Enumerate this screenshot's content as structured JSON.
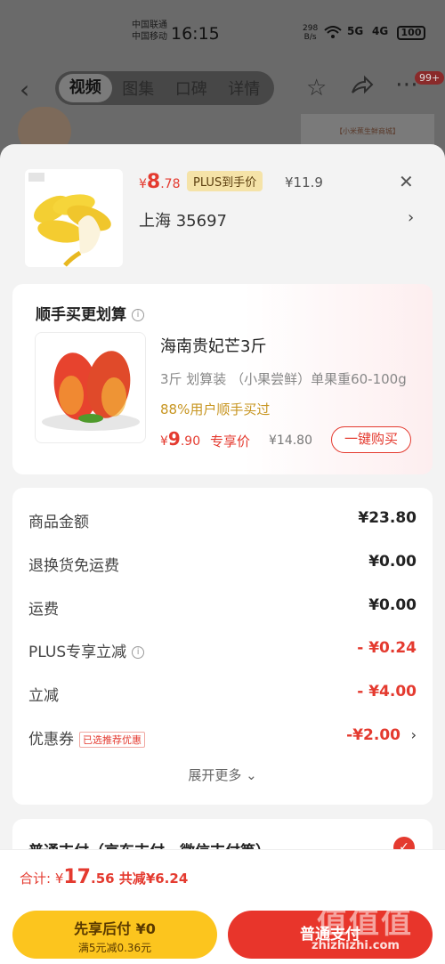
{
  "status_bar": {
    "carrier_1": "中国联通",
    "carrier_2": "中国移动",
    "time": "16:15",
    "net_speed_value": "298",
    "net_speed_unit": "B/s",
    "signal_1": "5G",
    "signal_2": "4G",
    "battery": "100"
  },
  "nav": {
    "tabs": [
      "视频",
      "图集",
      "口碑",
      "详情"
    ],
    "active_tab": "视频",
    "badge": "99+"
  },
  "background": {
    "card_text": "【小米蕉生鲜商城】"
  },
  "product": {
    "currency": "¥",
    "price_int": "8",
    "price_dec": ".78",
    "plus_tag": "PLUS到手价",
    "original_price": "¥11.9",
    "address": "上海  35697"
  },
  "upsell": {
    "title": "顺手买更划算",
    "name": "海南贵妃芒3斤",
    "spec": "3斤 划算装   （小果尝鲜）单果重60-100g",
    "percent": "88%用户顺手买过",
    "currency": "¥",
    "price_int": "9",
    "price_dec": ".90",
    "exclusive_label": "专享价",
    "original_price": "¥14.80",
    "buy_button": "一键购买"
  },
  "costs": {
    "rows": [
      {
        "label": "商品金额",
        "value": "¥23.80"
      },
      {
        "label": "退换货免运费",
        "value": "¥0.00"
      },
      {
        "label": "运费",
        "value": "¥0.00"
      },
      {
        "label": "PLUS专享立减",
        "value": "- ¥0.24"
      },
      {
        "label": "立减",
        "value": "- ¥4.00"
      },
      {
        "label": "优惠券",
        "tag": "已选推荐优惠",
        "value": "-¥2.00"
      }
    ],
    "expand": "展开更多"
  },
  "payment": {
    "method_title": "普通支付（京东支付、微信支付等）"
  },
  "footer": {
    "total_label": "合计: ",
    "currency": "¥",
    "total_int": "17",
    "total_dec": ".56",
    "reduce_label": " 共减",
    "reduce_value": "¥6.24",
    "later_line1": "先享后付 ¥0",
    "later_line2": "满5元减0.36元",
    "pay_button": "普通支付",
    "watermark": "zhizhizhi.com",
    "watermark_logo": "值值值"
  },
  "colors": {
    "accent_red": "#e43a2f",
    "gold": "#fcc51e",
    "plus_tag_bg": "#f5e3a8"
  }
}
